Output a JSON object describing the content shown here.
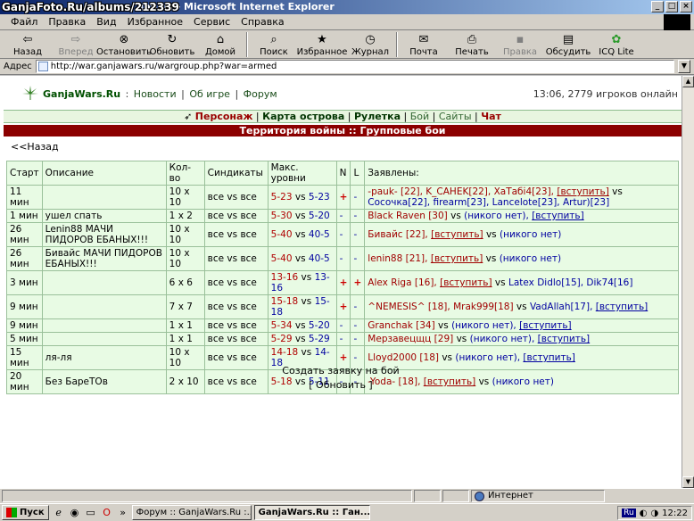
{
  "window": {
    "title": "войны - Microsoft Internet Explorer",
    "watermark": "GanjaFoto.Ru/albums/212339"
  },
  "menu": [
    "Файл",
    "Правка",
    "Вид",
    "Избранное",
    "Сервис",
    "Справка"
  ],
  "toolbar": {
    "back": "Назад",
    "forward": "Вперед",
    "stop": "Остановить",
    "refresh": "Обновить",
    "home": "Домой",
    "search": "Поиск",
    "favorites": "Избранное",
    "history": "Журнал",
    "mail": "Почта",
    "print": "Печать",
    "edit": "Правка",
    "discuss": "Обсудить",
    "icq": "ICQ Lite"
  },
  "address": {
    "label": "Адрес",
    "url": "http://war.ganjawars.ru/wargroup.php?war=armed"
  },
  "site": {
    "brand": "GanjaWars.Ru",
    "nav": [
      "Новости",
      "Об игре",
      "Форум"
    ],
    "status": "13:06, 2779 игроков онлайн",
    "subnav": [
      "Персонаж",
      "Карта острова",
      "Рулетка",
      "Бой",
      "Сайты",
      "Чат"
    ],
    "section_title": "Территория войны :: Групповые бои",
    "back_link": "<<Назад",
    "create_link": "Создать заявку на бой",
    "refresh_link": "[ Обновить ]"
  },
  "table": {
    "headers": [
      "Старт",
      "Описание",
      "Кол-во",
      "Синдикаты",
      "Макс. уровни",
      "N",
      "L",
      "Заявлены:"
    ],
    "rows": [
      {
        "start": "11 мин",
        "desc": "",
        "qty": "10 x 10",
        "synd": "все vs все",
        "lvl_a": "5-23",
        "lvl_b": "5-23",
        "n": "+",
        "l": "-",
        "side_a": "-pauk- [22], K_CAHEK[22], ХаТабі4[23],",
        "join_a": "[вступить]",
        "side_b": "Сосочка[22], firearm[23], Lancelote[23], Artur)[23]",
        "join_b": ""
      },
      {
        "start": "1 мин",
        "desc": "ушел спать",
        "qty": "1 x 2",
        "synd": "все vs все",
        "lvl_a": "5-30",
        "lvl_b": "5-20",
        "n": "-",
        "l": "-",
        "side_a": "Black Raven [30]",
        "join_a": "",
        "side_b": "(никого нет),",
        "join_b": "[вступить]"
      },
      {
        "start": "26 мин",
        "desc": "Lenin88 МАЧИ ПИДОРОВ ЕБАНЫХ!!!",
        "qty": "10 x 10",
        "synd": "все vs все",
        "lvl_a": "5-40",
        "lvl_b": "40-5",
        "n": "-",
        "l": "-",
        "side_a": "Бивайс [22],",
        "join_a": "[вступить]",
        "side_b": "(никого нет)",
        "join_b": ""
      },
      {
        "start": "26 мин",
        "desc": "Бивайс МАЧИ ПИДОРОВ ЕБАНЫХ!!!",
        "qty": "10 x 10",
        "synd": "все vs все",
        "lvl_a": "5-40",
        "lvl_b": "40-5",
        "n": "-",
        "l": "-",
        "side_a": "lenin88 [21],",
        "join_a": "[вступить]",
        "side_b": "(никого нет)",
        "join_b": ""
      },
      {
        "start": "3 мин",
        "desc": "",
        "qty": "6 x 6",
        "synd": "все vs все",
        "lvl_a": "13-16",
        "lvl_b": "13-16",
        "n": "+",
        "l": "+",
        "side_a": "Alex Riga [16],",
        "join_a": "[вступить]",
        "side_b": "Latex Didlo[15], Dik74[16]",
        "join_b": ""
      },
      {
        "start": "9 мин",
        "desc": "",
        "qty": "7 x 7",
        "synd": "все vs все",
        "lvl_a": "15-18",
        "lvl_b": "15-18",
        "n": "+",
        "l": "-",
        "side_a": "^NEMESIS^ [18], Mrak999[18]",
        "join_a": "",
        "side_b": "VadAllah[17],",
        "join_b": "[вступить]"
      },
      {
        "start": "9 мин",
        "desc": "",
        "qty": "1 x 1",
        "synd": "все vs все",
        "lvl_a": "5-34",
        "lvl_b": "5-20",
        "n": "-",
        "l": "-",
        "side_a": "Granchak [34]",
        "join_a": "",
        "side_b": "(никого нет),",
        "join_b": "[вступить]"
      },
      {
        "start": "5 мин",
        "desc": "",
        "qty": "1 x 1",
        "synd": "все vs все",
        "lvl_a": "5-29",
        "lvl_b": "5-29",
        "n": "-",
        "l": "-",
        "side_a": "Мерзавецщц [29]",
        "join_a": "",
        "side_b": "(никого нет),",
        "join_b": "[вступить]"
      },
      {
        "start": "15 мин",
        "desc": "ля-ля",
        "qty": "10 x 10",
        "synd": "все vs все",
        "lvl_a": "14-18",
        "lvl_b": "14-18",
        "n": "+",
        "l": "-",
        "side_a": "Lloyd2000 [18]",
        "join_a": "",
        "side_b": "(никого нет),",
        "join_b": "[вступить]"
      },
      {
        "start": "20 мин",
        "desc": "Без БареТОв",
        "qty": "2 x 10",
        "synd": "все vs все",
        "lvl_a": "5-18",
        "lvl_b": "5-11",
        "n": "-",
        "l": "-",
        "side_a": "-Yoda- [18],",
        "join_a": "[вступить]",
        "side_b": "(никого нет)",
        "join_b": ""
      }
    ]
  },
  "statusbar": {
    "zone": "Интернет"
  },
  "taskbar": {
    "start": "Пуск",
    "tasks": [
      "Форум :: GanjaWars.Ru :...",
      "GanjaWars.Ru :: Ган..."
    ],
    "lang": "Ru",
    "clock": "12:22"
  }
}
